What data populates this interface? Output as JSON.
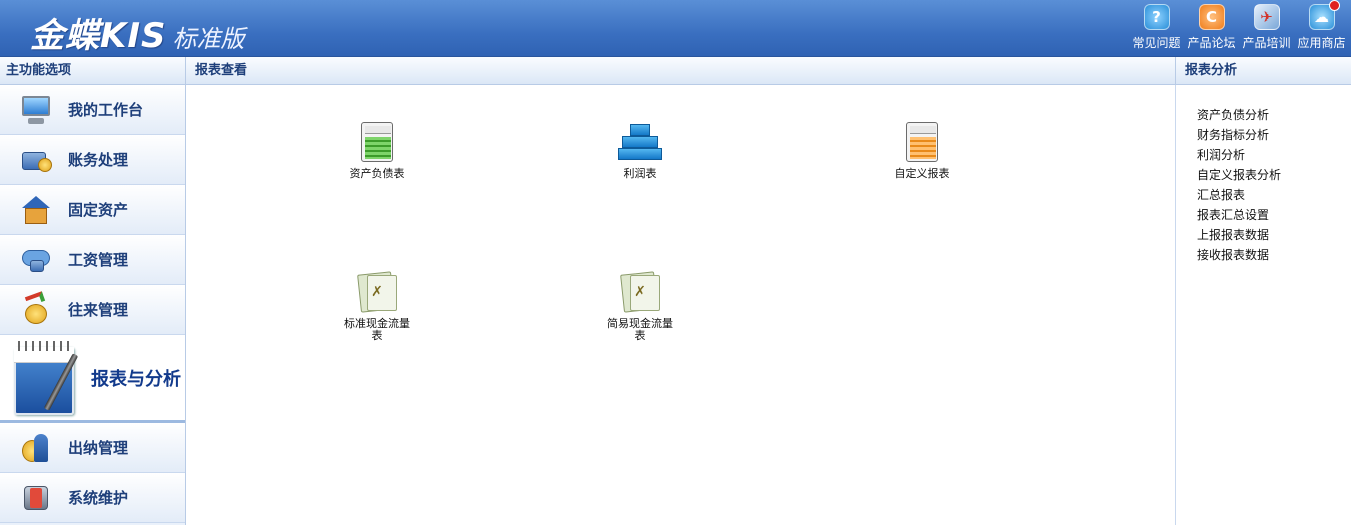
{
  "header": {
    "brand": "金蝶KIS",
    "edition": "标准版",
    "tools": [
      {
        "label": "常见问题",
        "icon": "help-question-icon",
        "color": "#3aa7e8"
      },
      {
        "label": "产品论坛",
        "icon": "forum-icon",
        "color": "#f07d1a"
      },
      {
        "label": "产品培训",
        "icon": "training-rocket-icon",
        "color": "#7aa7d8"
      },
      {
        "label": "应用商店",
        "icon": "app-store-icon",
        "color": "#2a8fd8"
      }
    ]
  },
  "nav": {
    "title": "主功能选项",
    "items": [
      {
        "label": "我的工作台",
        "icon": "monitor-icon"
      },
      {
        "label": "账务处理",
        "icon": "ledger-box-icon"
      },
      {
        "label": "固定资产",
        "icon": "house-icon"
      },
      {
        "label": "工资管理",
        "icon": "salary-cloud-icon"
      },
      {
        "label": "往来管理",
        "icon": "money-bag-icon"
      },
      {
        "label": "报表与分析",
        "icon": "notebook-pen-icon",
        "active": true
      },
      {
        "label": "出纳管理",
        "icon": "cashier-icon"
      },
      {
        "label": "系统维护",
        "icon": "system-tools-icon"
      }
    ]
  },
  "content": {
    "title": "报表查看",
    "reports": [
      {
        "label": "资产负债表",
        "icon": "balance-sheet-icon"
      },
      {
        "label": "利润表",
        "icon": "profit-blocks-icon"
      },
      {
        "label": "自定义报表",
        "icon": "custom-report-icon"
      },
      {
        "label": "标准现金流量表",
        "icon": "standard-cashflow-icon"
      },
      {
        "label": "简易现金流量表",
        "icon": "simple-cashflow-icon"
      }
    ]
  },
  "side": {
    "title": "报表分析",
    "links": [
      "资产负债分析",
      "财务指标分析",
      "利润分析",
      "自定义报表分析",
      "汇总报表",
      "报表汇总设置",
      "上报报表数据",
      "接收报表数据"
    ]
  },
  "colors": {
    "header_blue": "#3a6fc0",
    "nav_text": "#1e3f7a",
    "active_text": "#123a8c"
  }
}
